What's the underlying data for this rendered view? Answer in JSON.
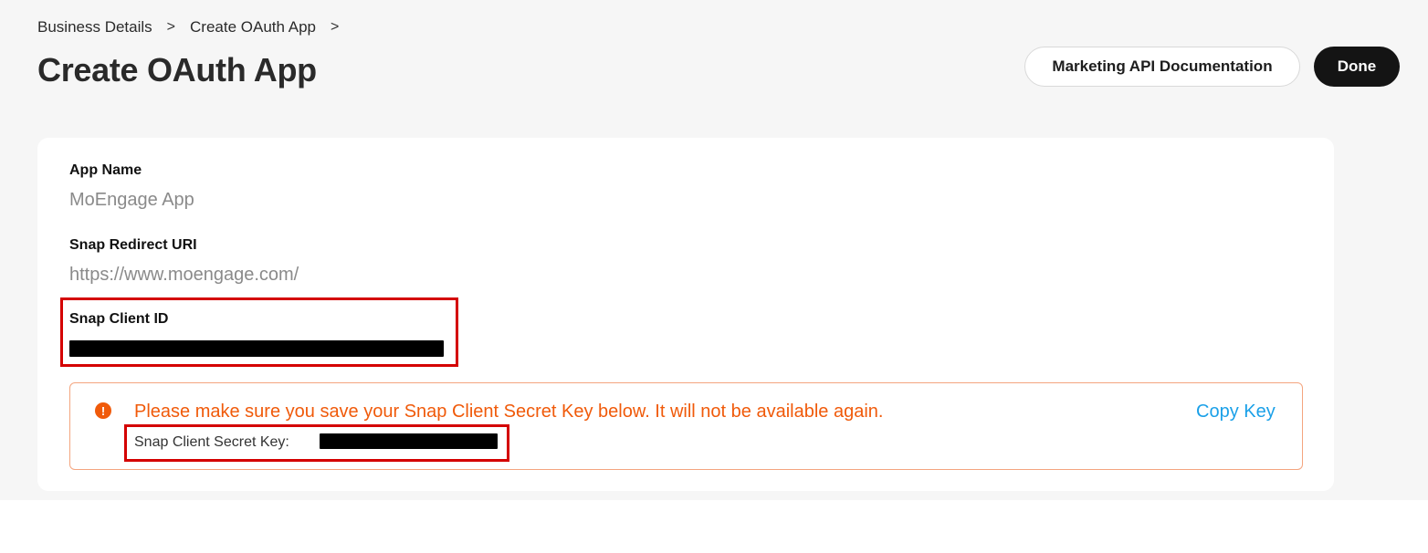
{
  "breadcrumb": {
    "items": [
      "Business Details",
      "Create OAuth App"
    ],
    "separator": ">"
  },
  "page": {
    "title": "Create OAuth App"
  },
  "header_actions": {
    "docs_label": "Marketing API Documentation",
    "done_label": "Done"
  },
  "fields": {
    "app_name_label": "App Name",
    "app_name_value": "MoEngage App",
    "redirect_label": "Snap Redirect URI",
    "redirect_value": "https://www.moengage.com/",
    "client_id_label": "Snap Client ID"
  },
  "alert": {
    "icon": "exclamation-icon",
    "message": "Please make sure you save your Snap Client Secret Key below. It will not be available again.",
    "copy_label": "Copy Key",
    "secret_label": "Snap Client Secret Key:"
  },
  "colors": {
    "alert_orange": "#f05a0a",
    "link_blue": "#1aa0e8",
    "highlight_red": "#d40000",
    "done_button": "#141414"
  }
}
